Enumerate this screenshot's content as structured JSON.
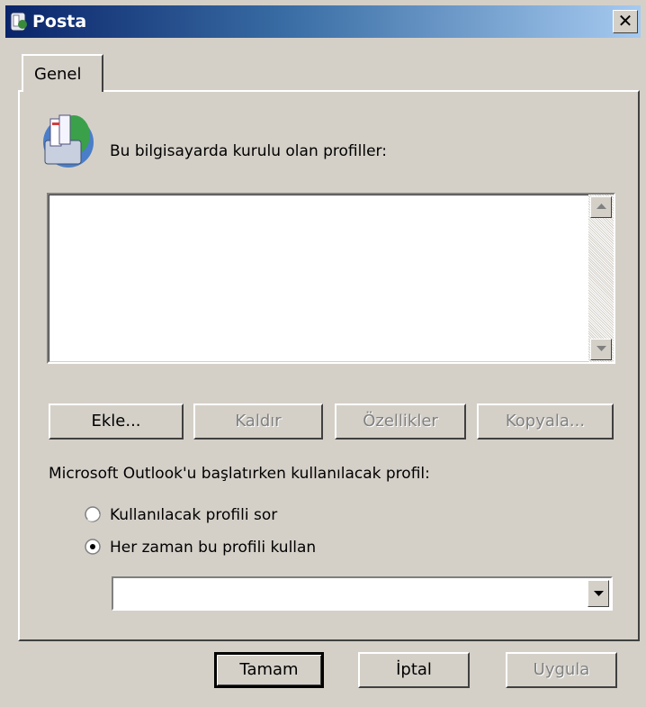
{
  "window": {
    "title": "Posta",
    "close_glyph": "✕"
  },
  "tabs": [
    {
      "label": "Genel"
    }
  ],
  "profiles_section": {
    "icon": "mail-profiles-icon",
    "label": "Bu bilgisayarda kurulu olan profiller:",
    "items": []
  },
  "buttons": {
    "add": "Ekle...",
    "remove": "Kaldır",
    "properties": "Özellikler",
    "copy": "Kopyala..."
  },
  "startup": {
    "label": "Microsoft Outlook'u başlatırken kullanılacak profil:",
    "options": [
      {
        "label": "Kullanılacak profili sor",
        "selected": false
      },
      {
        "label": "Her zaman bu profili kullan",
        "selected": true
      }
    ],
    "selected_profile": ""
  },
  "footer": {
    "ok": "Tamam",
    "cancel": "İptal",
    "apply": "Uygula"
  },
  "colors": {
    "face": "#d4d0c8",
    "title_start": "#0a246a",
    "title_end": "#a6caf0"
  }
}
